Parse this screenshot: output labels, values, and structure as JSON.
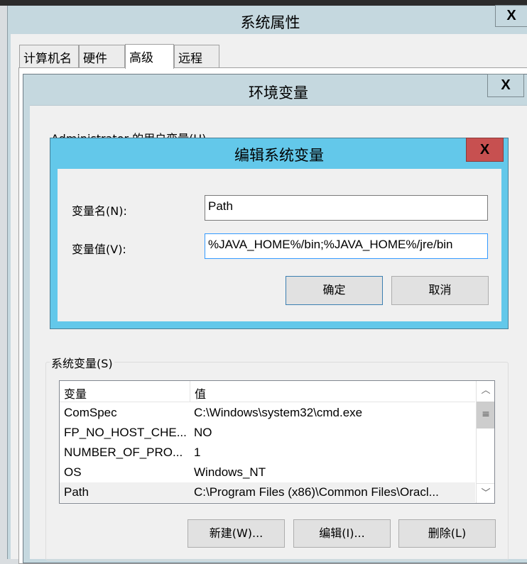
{
  "system_properties": {
    "title": "系统属性",
    "close": "X",
    "tabs": [
      {
        "label": "计算机名"
      },
      {
        "label": "硬件"
      },
      {
        "label": "高级",
        "active": true
      },
      {
        "label": "远程"
      }
    ]
  },
  "env_vars": {
    "title": "环境变量",
    "close": "X",
    "user_vars_label": "Administrator 的用户变量(U)",
    "system_vars_label": "系统变量(S)",
    "columns": [
      "变量",
      "值"
    ],
    "rows": [
      {
        "name": "ComSpec",
        "value": "C:\\Windows\\system32\\cmd.exe"
      },
      {
        "name": "FP_NO_HOST_CHE...",
        "value": "NO"
      },
      {
        "name": "NUMBER_OF_PRO...",
        "value": "1"
      },
      {
        "name": "OS",
        "value": "Windows_NT"
      },
      {
        "name": "Path",
        "value": "C:\\Program Files (x86)\\Common Files\\Oracl...",
        "selected": true
      }
    ],
    "buttons": {
      "new": "新建(W)...",
      "edit": "编辑(I)...",
      "delete": "删除(L)"
    }
  },
  "edit_dialog": {
    "title": "编辑系统变量",
    "close": "X",
    "name_label": "变量名(N):",
    "name_value": "Path",
    "value_label": "变量值(V):",
    "value_value": "%JAVA_HOME%/bin;%JAVA_HOME%/jre/bin",
    "ok": "确定",
    "cancel": "取消"
  },
  "colors": {
    "edit_title": "#63c8ea",
    "close_red": "#c75050",
    "title_bar": "#c5d8df"
  }
}
